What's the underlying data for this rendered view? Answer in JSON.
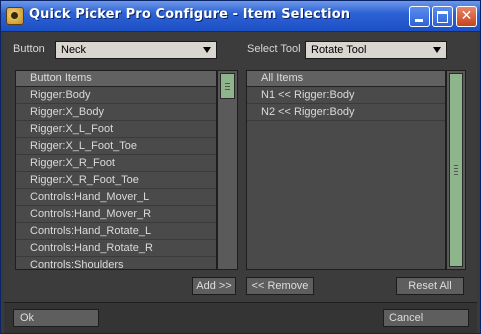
{
  "window": {
    "title": "Quick Picker Pro Configure - Item Selection"
  },
  "controls": {
    "button_label": "Button",
    "button_value": "Neck",
    "select_tool_label": "Select Tool",
    "select_tool_value": "Rotate Tool"
  },
  "left_list": {
    "header": "Button Items",
    "items": [
      "Rigger:Body",
      "Rigger:X_Body",
      "Rigger:X_L_Foot",
      "Rigger:X_L_Foot_Toe",
      "Rigger:X_R_Foot",
      "Rigger:X_R_Foot_Toe",
      "Controls:Hand_Mover_L",
      "Controls:Hand_Mover_R",
      "Controls:Hand_Rotate_L",
      "Controls:Hand_Rotate_R",
      "Controls:Shoulders"
    ]
  },
  "right_list": {
    "header": "All Items",
    "items": [
      "N1 << Rigger:Body",
      "N2 << Rigger:Body"
    ]
  },
  "buttons": {
    "add": "Add >>",
    "remove": "<< Remove",
    "reset_all": "Reset All",
    "ok": "Ok",
    "cancel": "Cancel"
  }
}
